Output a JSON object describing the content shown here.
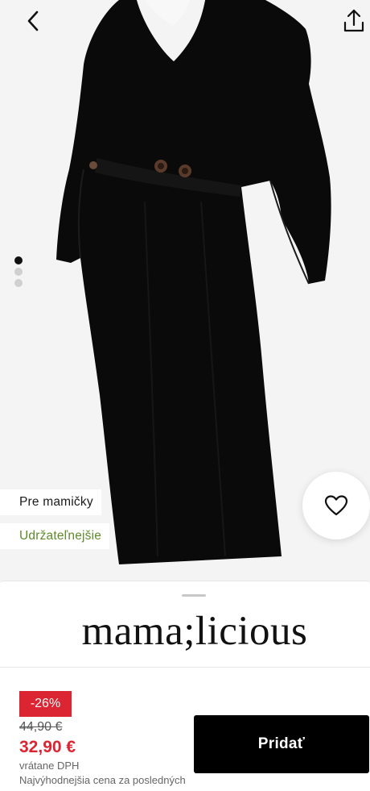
{
  "navigation": {
    "back_icon": "chevron-left-icon",
    "share_icon": "share-icon"
  },
  "gallery": {
    "image_subject": "black-dress-image",
    "active_slide": 1,
    "total_slides": 3
  },
  "tags": {
    "maternity": "Pre mamičky",
    "sustainable": "Udržateľnejšie"
  },
  "favorite": {
    "icon": "heart-icon"
  },
  "product": {
    "brand": "mama;licious",
    "discount": "-26%",
    "old_price": "44,90 €",
    "price": "32,90 €",
    "vat_note": "vrátane DPH",
    "lowest_price_note": "Najvýhodnejšia cena za posledných"
  },
  "actions": {
    "add_label": "Pridať"
  },
  "colors": {
    "sale": "#dc2532",
    "sustainable": "#5f8a2a",
    "button": "#000000"
  }
}
